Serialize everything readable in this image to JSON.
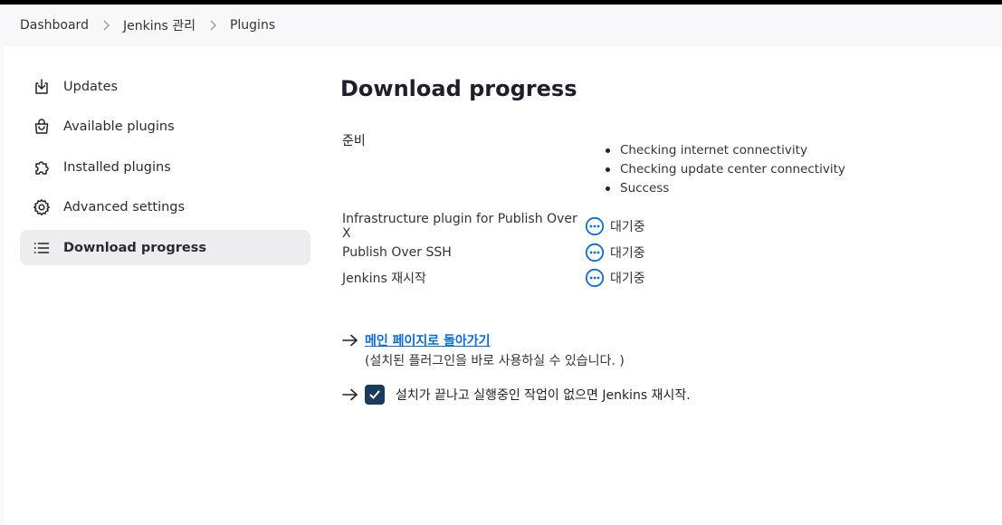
{
  "breadcrumbs": [
    "Dashboard",
    "Jenkins 관리",
    "Plugins"
  ],
  "sidebar": {
    "items": [
      {
        "label": "Updates",
        "icon": "download-icon",
        "active": false
      },
      {
        "label": "Available plugins",
        "icon": "shopping-bag-icon",
        "active": false
      },
      {
        "label": "Installed plugins",
        "icon": "puzzle-icon",
        "active": false
      },
      {
        "label": "Advanced settings",
        "icon": "gear-icon",
        "active": false
      },
      {
        "label": "Download progress",
        "icon": "list-icon",
        "active": true
      }
    ]
  },
  "main": {
    "title": "Download progress",
    "preparation": {
      "label": "준비",
      "checks": [
        "Checking internet connectivity",
        "Checking update center connectivity",
        "Success"
      ]
    },
    "statuses": [
      {
        "name": "Infrastructure plugin for Publish Over X",
        "status": "대기중"
      },
      {
        "name": "Publish Over SSH",
        "status": "대기중"
      },
      {
        "name": "Jenkins 재시작",
        "status": "대기중"
      }
    ],
    "back_link": "메인 페이지로 돌아가기",
    "back_note": "(설치된 플러그인을 바로 사용하실 수 있습니다. )",
    "restart_label": "설치가 끝나고 실행중인 작업이 없으면 Jenkins 재시작.",
    "restart_checked": true
  },
  "colors": {
    "accent": "#0b6bd6",
    "checkbox": "#1c3a5e",
    "active_bg": "#ededf0"
  }
}
